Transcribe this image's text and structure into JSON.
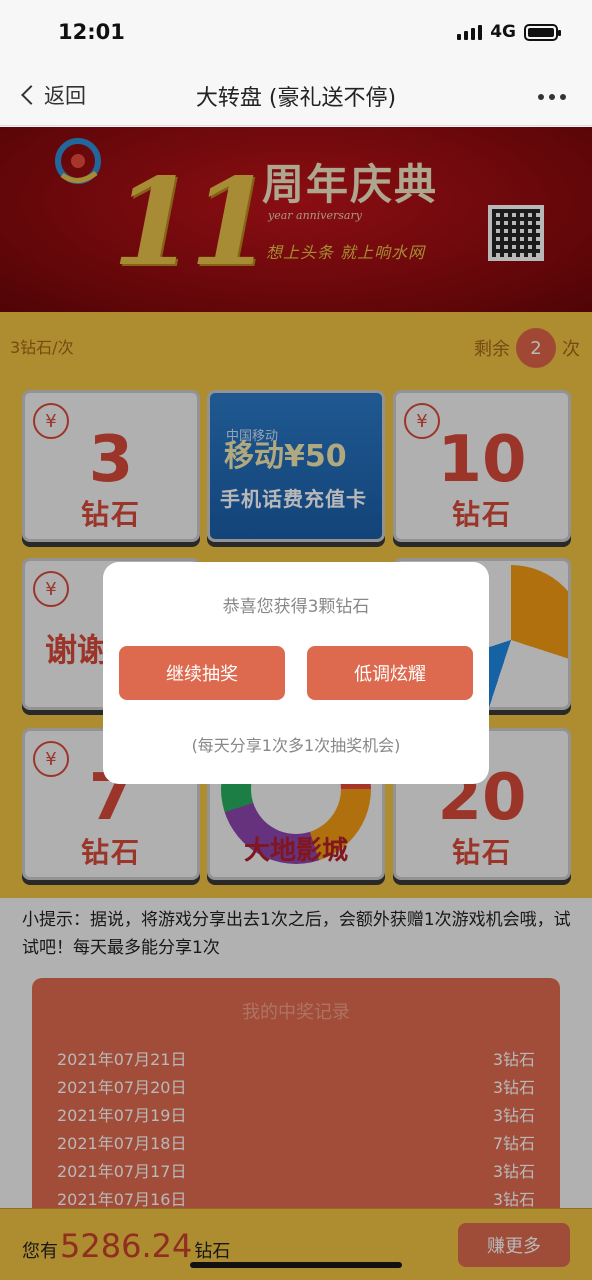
{
  "status_bar": {
    "time": "12:01",
    "network": "4G"
  },
  "nav": {
    "back_label": "返回",
    "title": "大转盘 (豪礼送不停)"
  },
  "banner": {
    "number": "11",
    "title": "周年庆典",
    "subtitle": "year anniversary",
    "slogan": "想上头条 就上响水网"
  },
  "game": {
    "cost": "3钻石/次",
    "remaining_prefix": "剩余",
    "remaining_count": "2",
    "remaining_suffix": "次",
    "currency_symbol": "¥",
    "prizes": {
      "p1": {
        "number": "3",
        "unit": "钻石"
      },
      "p2": {
        "top": "中国移动",
        "big": "移动¥50",
        "small": "手机话费充值卡"
      },
      "p3": {
        "number": "10",
        "unit": "钻石"
      },
      "p4": {
        "text": "谢谢"
      },
      "p7": {
        "number": "7",
        "unit": "钻石"
      },
      "p8": {
        "label": "大地影城"
      },
      "p9": {
        "number": "20",
        "unit": "钻石"
      }
    }
  },
  "tip": "小提示：据说，将游戏分享出去1次之后，会额外获赠1次游戏机会哦，试试吧！每天最多能分享1次",
  "records": {
    "title": "我的中奖记录",
    "rows": [
      {
        "date": "2021年07月21日",
        "prize": "3钻石"
      },
      {
        "date": "2021年07月20日",
        "prize": "3钻石"
      },
      {
        "date": "2021年07月19日",
        "prize": "3钻石"
      },
      {
        "date": "2021年07月18日",
        "prize": "7钻石"
      },
      {
        "date": "2021年07月17日",
        "prize": "3钻石"
      },
      {
        "date": "2021年07月16日",
        "prize": "3钻石"
      }
    ]
  },
  "footer": {
    "prefix": "您有",
    "amount": "5286.24",
    "suffix": "钻石",
    "earn_label": "赚更多"
  },
  "modal": {
    "message": "恭喜您获得3颗钻石",
    "continue_label": "继续抽奖",
    "share_label": "低调炫耀",
    "note": "(每天分享1次多1次抽奖机会)"
  },
  "colors": {
    "accent": "#dd6a4f",
    "board": "#f1c243",
    "banner": "#a50f14",
    "prize_text": "#d94a3a"
  }
}
